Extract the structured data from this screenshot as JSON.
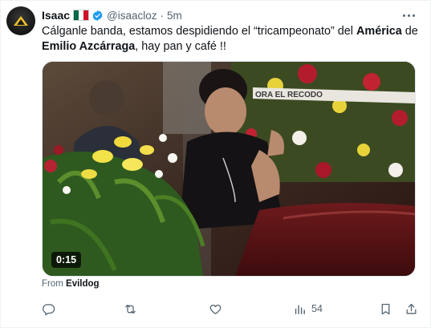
{
  "post": {
    "author_name": "Isaac",
    "handle": "@isaacloz",
    "separator": "·",
    "time": "5m",
    "text": {
      "part1": "Cálganle banda, estamos despidiendo el “tricampeonato” del ",
      "bold1": "América",
      "part2": " de ",
      "bold2": "Emilio Azcárraga",
      "part3": ", hay pan y café !!"
    },
    "media": {
      "duration": "0:15",
      "banner_text": "ORA EL RECODO"
    },
    "source": {
      "prefix": "From ",
      "name": "Evildog"
    },
    "metrics": {
      "views": "54"
    }
  },
  "colors": {
    "verified_blue": "#1d9bf0",
    "muted_text": "#536471",
    "primary_text": "#0f1419"
  },
  "icons": [
    "more-icon",
    "reply-icon",
    "repost-icon",
    "like-icon",
    "views-icon",
    "bookmark-icon",
    "share-icon",
    "verified-badge-icon",
    "mexico-flag-icon"
  ]
}
